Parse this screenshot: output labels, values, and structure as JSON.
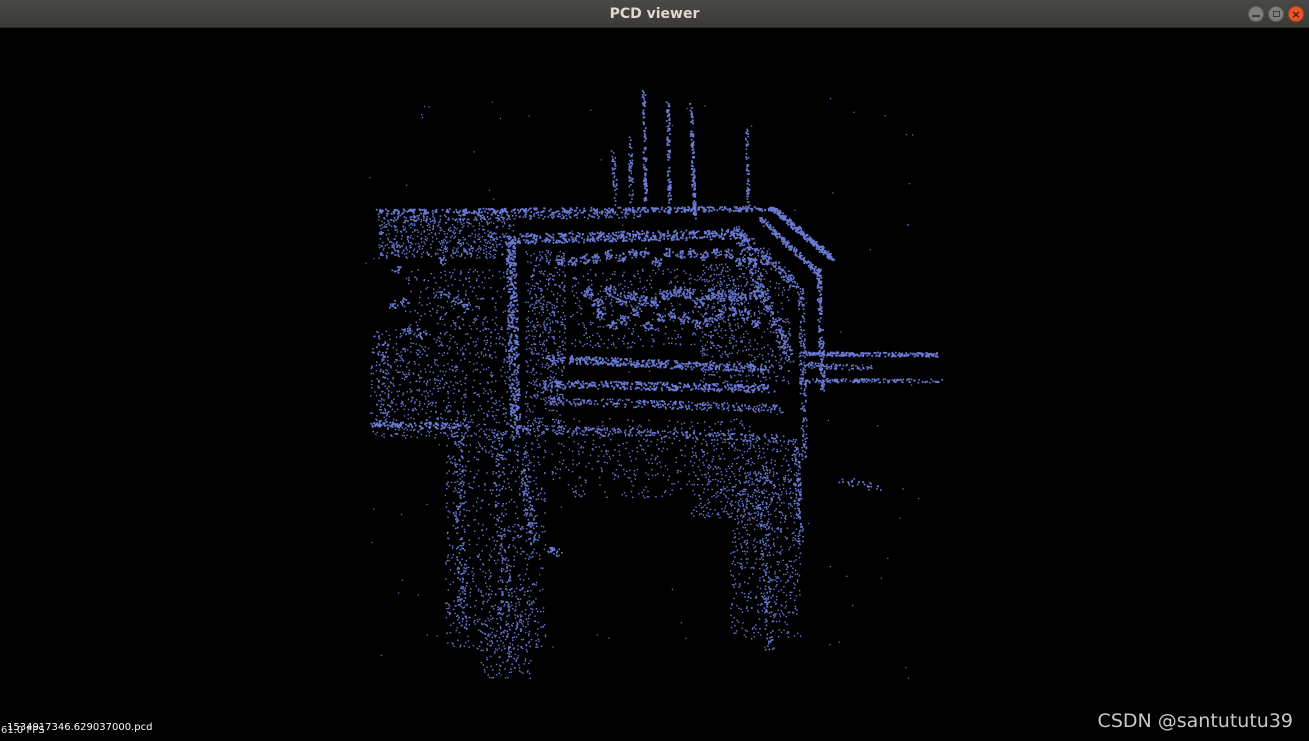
{
  "window": {
    "title": "PCD viewer",
    "controls": {
      "minimize_icon": "minimize-icon",
      "maximize_icon": "maximize-icon",
      "close_icon": "close-icon"
    }
  },
  "viewer": {
    "background_color": "#000000",
    "point_color": "#6b7bd6",
    "fps_label": "61.0 FPS",
    "file_label": "1534917346.629037000.pcd"
  },
  "watermark": "CSDN @santututu39"
}
